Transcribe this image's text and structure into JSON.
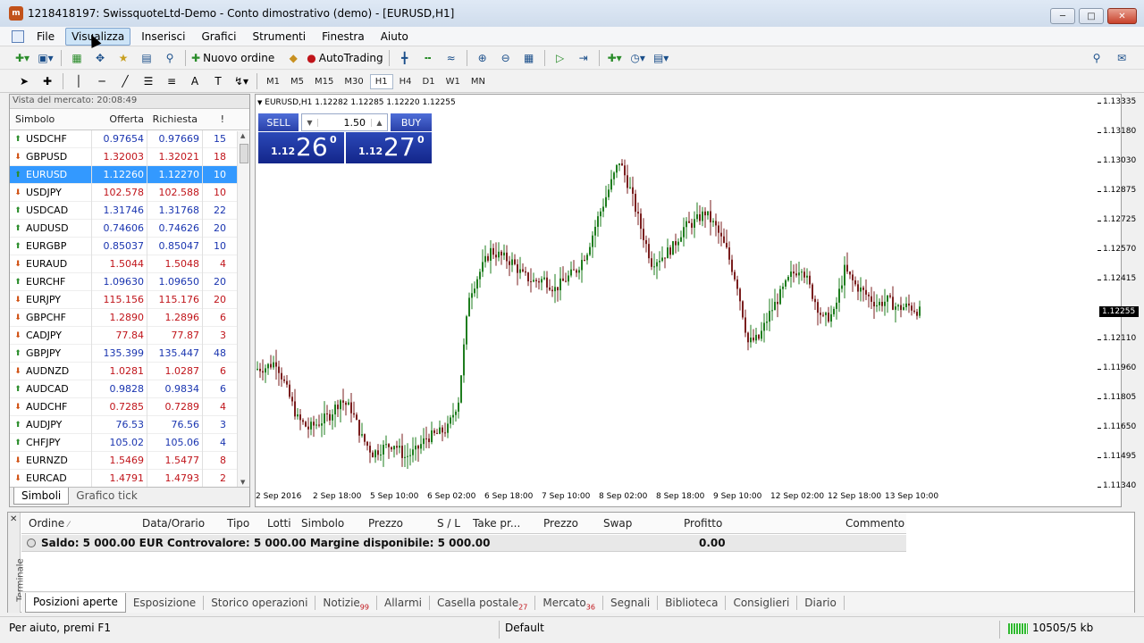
{
  "window": {
    "title": "1218418197: SwissquoteLtd-Demo - Conto dimostrativo (demo) - [EURUSD,H1]"
  },
  "menu": {
    "items": [
      "File",
      "Visualizza",
      "Inserisci",
      "Grafici",
      "Strumenti",
      "Finestra",
      "Aiuto"
    ]
  },
  "toolbar": {
    "new_order": "Nuovo ordine",
    "autotrading": "AutoTrading"
  },
  "timeframes": [
    "M1",
    "M5",
    "M15",
    "M30",
    "H1",
    "H4",
    "D1",
    "W1",
    "MN"
  ],
  "market_watch": {
    "title": "Vista del mercato: 20:08:49",
    "columns": {
      "symbol": "Simbolo",
      "bid": "Offerta",
      "ask": "Richiesta",
      "spread": "!"
    },
    "rows": [
      {
        "symbol": "USDCHF",
        "bid": "0.97654",
        "ask": "0.97669",
        "spread": "15",
        "dir": "up",
        "color": "blue"
      },
      {
        "symbol": "GBPUSD",
        "bid": "1.32003",
        "ask": "1.32021",
        "spread": "18",
        "dir": "down",
        "color": "red"
      },
      {
        "symbol": "EURUSD",
        "bid": "1.12260",
        "ask": "1.12270",
        "spread": "10",
        "dir": "up",
        "color": "sel"
      },
      {
        "symbol": "USDJPY",
        "bid": "102.578",
        "ask": "102.588",
        "spread": "10",
        "dir": "down",
        "color": "red"
      },
      {
        "symbol": "USDCAD",
        "bid": "1.31746",
        "ask": "1.31768",
        "spread": "22",
        "dir": "up",
        "color": "blue"
      },
      {
        "symbol": "AUDUSD",
        "bid": "0.74606",
        "ask": "0.74626",
        "spread": "20",
        "dir": "up",
        "color": "blue"
      },
      {
        "symbol": "EURGBP",
        "bid": "0.85037",
        "ask": "0.85047",
        "spread": "10",
        "dir": "up",
        "color": "blue"
      },
      {
        "symbol": "EURAUD",
        "bid": "1.5044",
        "ask": "1.5048",
        "spread": "4",
        "dir": "down",
        "color": "red"
      },
      {
        "symbol": "EURCHF",
        "bid": "1.09630",
        "ask": "1.09650",
        "spread": "20",
        "dir": "up",
        "color": "blue"
      },
      {
        "symbol": "EURJPY",
        "bid": "115.156",
        "ask": "115.176",
        "spread": "20",
        "dir": "down",
        "color": "red"
      },
      {
        "symbol": "GBPCHF",
        "bid": "1.2890",
        "ask": "1.2896",
        "spread": "6",
        "dir": "down",
        "color": "red"
      },
      {
        "symbol": "CADJPY",
        "bid": "77.84",
        "ask": "77.87",
        "spread": "3",
        "dir": "down",
        "color": "red"
      },
      {
        "symbol": "GBPJPY",
        "bid": "135.399",
        "ask": "135.447",
        "spread": "48",
        "dir": "up",
        "color": "blue"
      },
      {
        "symbol": "AUDNZD",
        "bid": "1.0281",
        "ask": "1.0287",
        "spread": "6",
        "dir": "down",
        "color": "red"
      },
      {
        "symbol": "AUDCAD",
        "bid": "0.9828",
        "ask": "0.9834",
        "spread": "6",
        "dir": "up",
        "color": "blue"
      },
      {
        "symbol": "AUDCHF",
        "bid": "0.7285",
        "ask": "0.7289",
        "spread": "4",
        "dir": "down",
        "color": "red"
      },
      {
        "symbol": "AUDJPY",
        "bid": "76.53",
        "ask": "76.56",
        "spread": "3",
        "dir": "up",
        "color": "blue"
      },
      {
        "symbol": "CHFJPY",
        "bid": "105.02",
        "ask": "105.06",
        "spread": "4",
        "dir": "up",
        "color": "blue"
      },
      {
        "symbol": "EURNZD",
        "bid": "1.5469",
        "ask": "1.5477",
        "spread": "8",
        "dir": "down",
        "color": "red"
      },
      {
        "symbol": "EURCAD",
        "bid": "1.4791",
        "ask": "1.4793",
        "spread": "2",
        "dir": "down",
        "color": "red"
      }
    ],
    "tabs": [
      "Simboli",
      "Grafico tick"
    ]
  },
  "chart": {
    "label": "EURUSD,H1  1.12282 1.12285 1.12220 1.12255",
    "one_click": {
      "sell": "SELL",
      "buy": "BUY",
      "lot": "1.50",
      "sell_prefix": "1.12",
      "sell_big": "26",
      "sell_sup": "0",
      "buy_prefix": "1.12",
      "buy_big": "27",
      "buy_sup": "0"
    },
    "current_price": "1.12255"
  },
  "chart_data": {
    "type": "candlestick",
    "symbol": "EURUSD",
    "timeframe": "H1",
    "y_ticks": [
      "1.13335",
      "1.13180",
      "1.13030",
      "1.12875",
      "1.12725",
      "1.12570",
      "1.12415",
      "1.12255",
      "1.12110",
      "1.11960",
      "1.11805",
      "1.11650",
      "1.11495",
      "1.11340"
    ],
    "x_ticks": [
      "2 Sep 2016",
      "2 Sep 18:00",
      "5 Sep 10:00",
      "6 Sep 02:00",
      "6 Sep 18:00",
      "7 Sep 10:00",
      "8 Sep 02:00",
      "8 Sep 18:00",
      "9 Sep 10:00",
      "12 Sep 02:00",
      "12 Sep 18:00",
      "13 Sep 10:00"
    ],
    "ylim": [
      1.1134,
      1.1335
    ],
    "close_path": [
      1.1196,
      1.1197,
      1.12,
      1.1185,
      1.117,
      1.1165,
      1.1168,
      1.1172,
      1.118,
      1.1175,
      1.116,
      1.1152,
      1.1155,
      1.1157,
      1.115,
      1.1153,
      1.116,
      1.1162,
      1.1165,
      1.118,
      1.1235,
      1.1247,
      1.1258,
      1.1255,
      1.1252,
      1.1245,
      1.1242,
      1.1243,
      1.1238,
      1.1243,
      1.1248,
      1.1258,
      1.1275,
      1.129,
      1.1305,
      1.129,
      1.127,
      1.1252,
      1.1255,
      1.126,
      1.127,
      1.1273,
      1.1278,
      1.127,
      1.1258,
      1.124,
      1.121,
      1.1212,
      1.1225,
      1.1235,
      1.1245,
      1.125,
      1.1235,
      1.1222,
      1.1225,
      1.1248,
      1.124,
      1.1235,
      1.123,
      1.1232,
      1.1228,
      1.1229,
      1.1226
    ]
  },
  "terminal": {
    "side_label": "Terminale",
    "columns": [
      "Ordine",
      "Data/Orario",
      "Tipo",
      "Lotti",
      "Simbolo",
      "Prezzo",
      "S / L",
      "Take pr...",
      "Prezzo",
      "Swap",
      "Profitto",
      "Commento"
    ],
    "balance_text": "Saldo: 5 000.00 EUR  Controvalore: 5 000.00  Margine disponibile: 5 000.00",
    "profit": "0.00",
    "tabs": [
      {
        "label": "Posizioni aperte",
        "badge": ""
      },
      {
        "label": "Esposizione",
        "badge": ""
      },
      {
        "label": "Storico operazioni",
        "badge": ""
      },
      {
        "label": "Notizie",
        "badge": "99"
      },
      {
        "label": "Allarmi",
        "badge": ""
      },
      {
        "label": "Casella postale",
        "badge": "27"
      },
      {
        "label": "Mercato",
        "badge": "36"
      },
      {
        "label": "Segnali",
        "badge": ""
      },
      {
        "label": "Biblioteca",
        "badge": ""
      },
      {
        "label": "Consiglieri",
        "badge": ""
      },
      {
        "label": "Diario",
        "badge": ""
      }
    ]
  },
  "status": {
    "help": "Per aiuto, premi F1",
    "profile": "Default",
    "traffic": "10505/5 kb"
  }
}
